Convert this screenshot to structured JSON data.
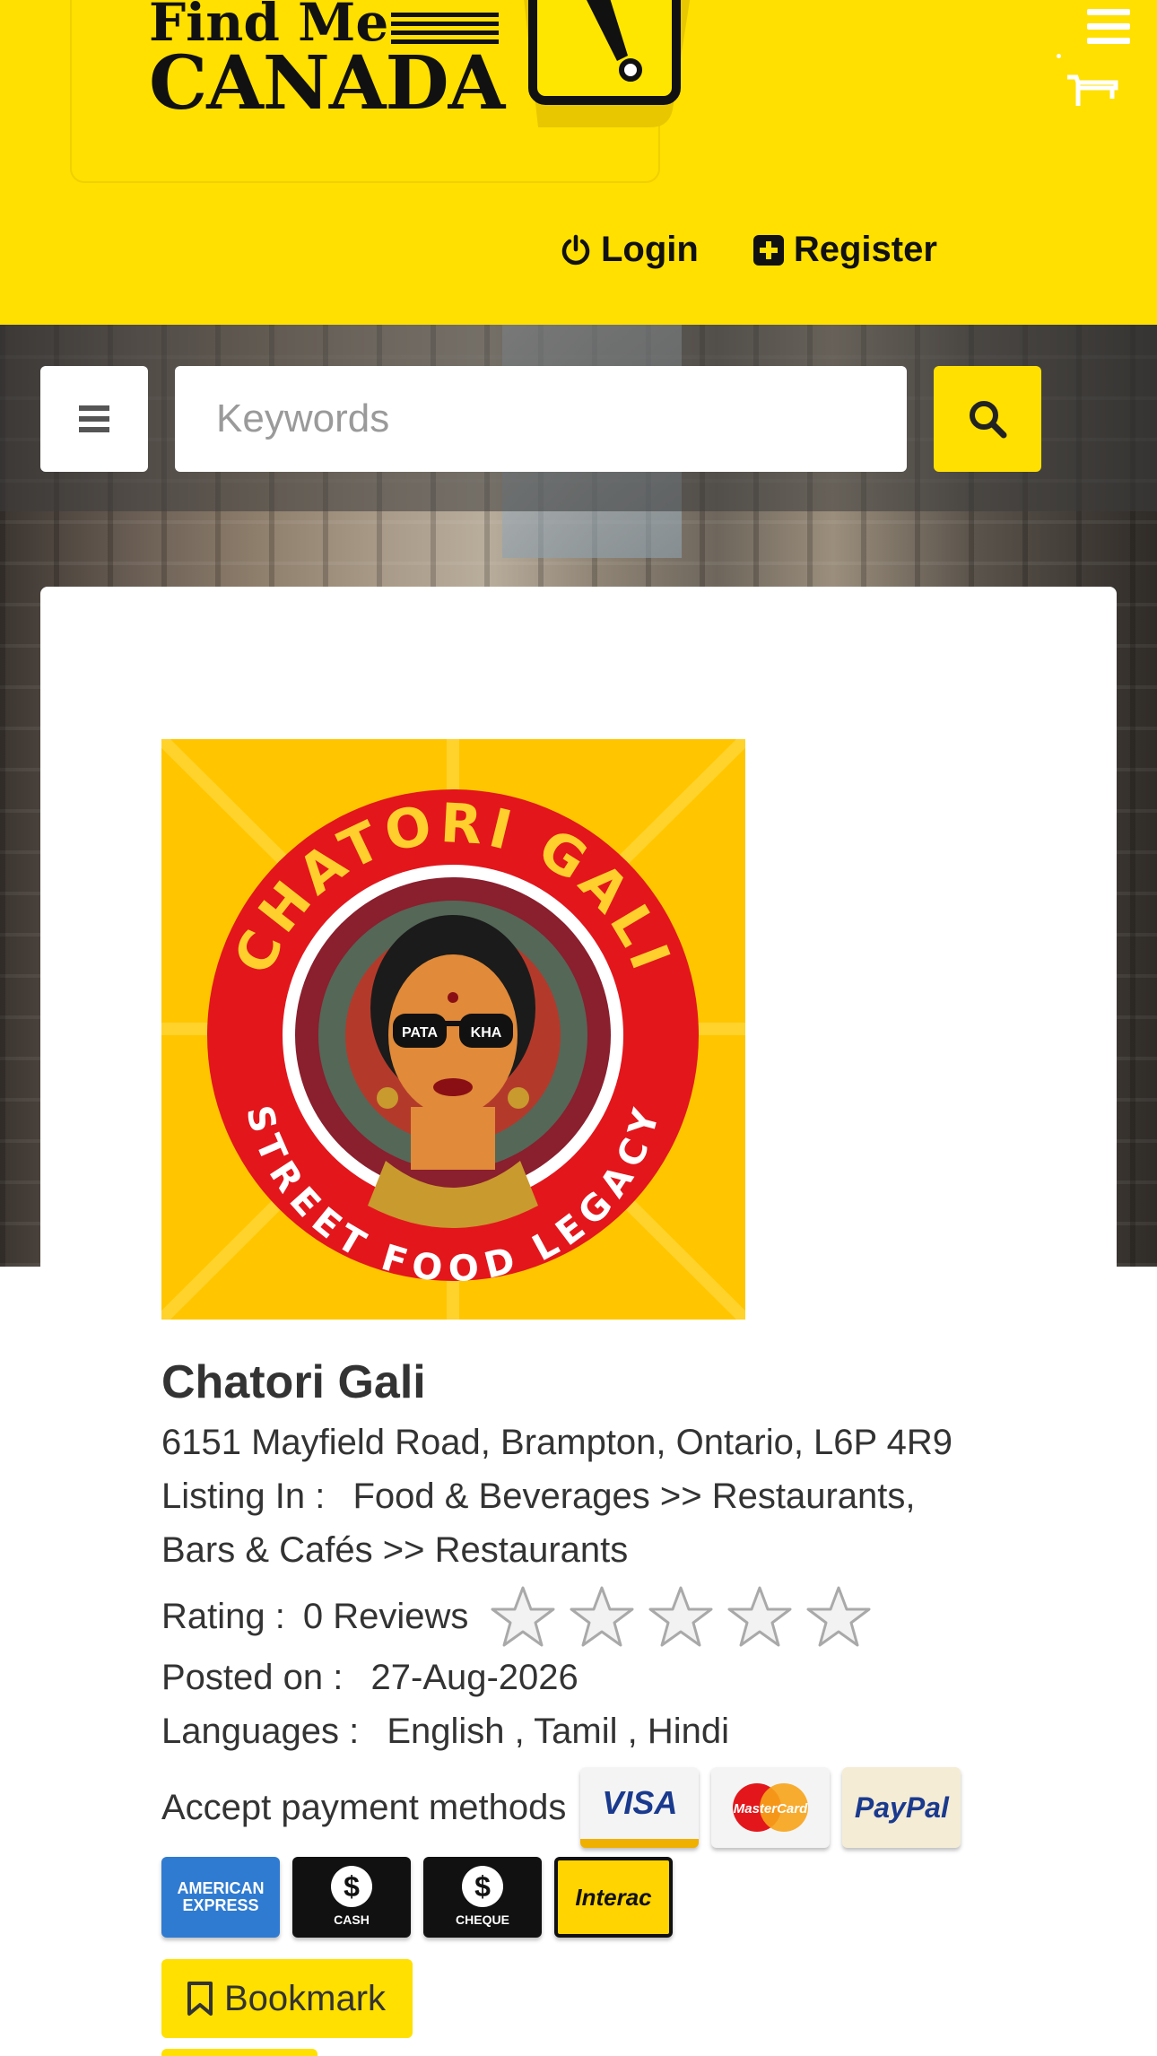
{
  "header": {
    "logo": {
      "line1": "Find Me",
      "line2": "CANADA"
    },
    "login_label": "Login",
    "register_label": "Register"
  },
  "search": {
    "placeholder": "Keywords"
  },
  "listing": {
    "logo_text": {
      "top": "CHATORI GALI",
      "bottom": "STREET FOOD LEGACY",
      "glasses_left": "PATA",
      "glasses_right": "KHA"
    },
    "name": "Chatori Gali",
    "address": "6151 Mayfield Road, Brampton, Ontario, L6P 4R9",
    "listing_in_label": "Listing In :",
    "listing_in_line1": "Food & Beverages >> Restaurants,",
    "listing_in_line2": "Bars & Cafés >> Restaurants",
    "rating_label": "Rating :",
    "reviews": "0 Reviews",
    "rating_value": 0,
    "rating_max": 5,
    "posted_label": "Posted on :",
    "posted_date": "27-Aug-2026",
    "languages_label": "Languages :",
    "languages": "English , Tamil , Hindi",
    "payment_label": "Accept payment methods",
    "payment_methods": {
      "visa": "VISA",
      "mastercard": "MasterCard",
      "paypal": "PayPal",
      "amex_line1": "AMERICAN",
      "amex_line2": "EXPRESS",
      "cash": "CASH",
      "cheque": "CHEQUE",
      "interac": "Interac"
    },
    "bookmark_label": "Bookmark"
  },
  "colors": {
    "brand_yellow": "#ffe000",
    "text": "#333333",
    "logo_red": "#e3161c"
  },
  "icons": [
    "hamburger-icon",
    "cart-icon",
    "power-icon",
    "plus-square-icon",
    "bars-icon",
    "search-icon",
    "star-icon",
    "bookmark-icon"
  ]
}
